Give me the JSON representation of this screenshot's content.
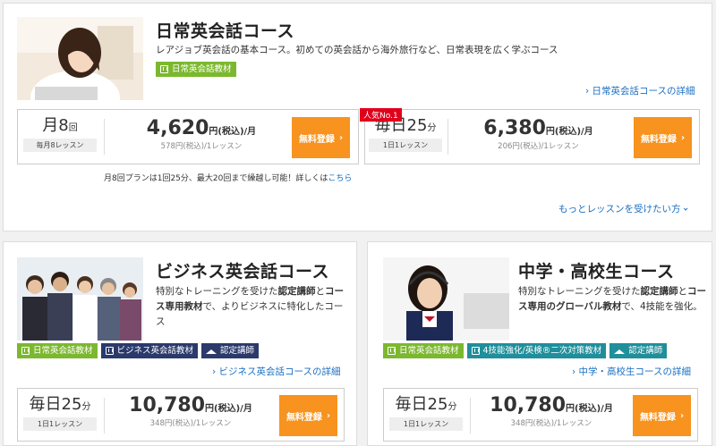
{
  "colors": {
    "accent": "#f7931e",
    "link": "#1a6fc2",
    "green_tag": "#7cb82f",
    "navy_tag": "#2b3a6b",
    "teal_tag": "#1f8f9b",
    "badge": "#e0001b"
  },
  "daily": {
    "title": "日常英会話コース",
    "desc": "レアジョブ英会話の基本コース。初めての英会話から海外旅行など、日常表現を広く学ぶコース",
    "tags": [
      {
        "label": "日常英会話教材",
        "icon": "book-icon"
      }
    ],
    "detail_link": "› 日常英会話コースの詳細",
    "plans": [
      {
        "freq_prefix": "月",
        "freq_num": "8",
        "freq_unit": "回",
        "freq_sub": "毎月8レッスン",
        "price": "4,620",
        "price_unit": "円(税込)/月",
        "per_lesson": "578円(税込)/1レッスン",
        "button": "無料登録"
      },
      {
        "badge": "人気No.1",
        "freq_prefix": "毎日",
        "freq_num": "25",
        "freq_unit": "分",
        "freq_sub": "1日1レッスン",
        "price": "6,380",
        "price_unit": "円(税込)/月",
        "per_lesson": "206円(税込)/1レッスン",
        "button": "無料登録"
      }
    ],
    "note": "月8回プランは1回25分、最大20回まで繰越し可能！詳しくは",
    "note_link": "こちら",
    "more_link": "もっとレッスンを受けたい方"
  },
  "business": {
    "title": "ビジネス英会話コース",
    "desc_1": "特別なトレーニングを受けた",
    "desc_bold_1": "認定講師",
    "desc_2": "と",
    "desc_bold_2": "コース専用教材",
    "desc_3": "で、よりビジネスに特化したコース",
    "tags": [
      {
        "label": "日常英会話教材"
      },
      {
        "label": "ビジネス英会話教材"
      },
      {
        "label": "認定講師"
      }
    ],
    "detail_link": "› ビジネス英会話コースの詳細",
    "plan": {
      "freq_prefix": "毎日",
      "freq_num": "25",
      "freq_unit": "分",
      "freq_sub": "1日1レッスン",
      "price": "10,780",
      "price_unit": "円(税込)/月",
      "per_lesson": "348円(税込)/1レッスン",
      "button": "無料登録"
    }
  },
  "junior": {
    "title": "中学・高校生コース",
    "desc_1": "特別なトレーニングを受けた",
    "desc_bold_1": "認定講師",
    "desc_2": "と",
    "desc_bold_2": "コース専用のグローバル教材",
    "desc_3": "で、4技能を強化。",
    "tags": [
      {
        "label": "日常英会話教材"
      },
      {
        "label": "4技能強化/英検®二次対策教材"
      },
      {
        "label": "認定講師"
      }
    ],
    "detail_link": "› 中学・高校生コースの詳細",
    "plan": {
      "freq_prefix": "毎日",
      "freq_num": "25",
      "freq_unit": "分",
      "freq_sub": "1日1レッスン",
      "price": "10,780",
      "price_unit": "円(税込)/月",
      "per_lesson": "348円(税込)/1レッスン",
      "button": "無料登録"
    }
  }
}
